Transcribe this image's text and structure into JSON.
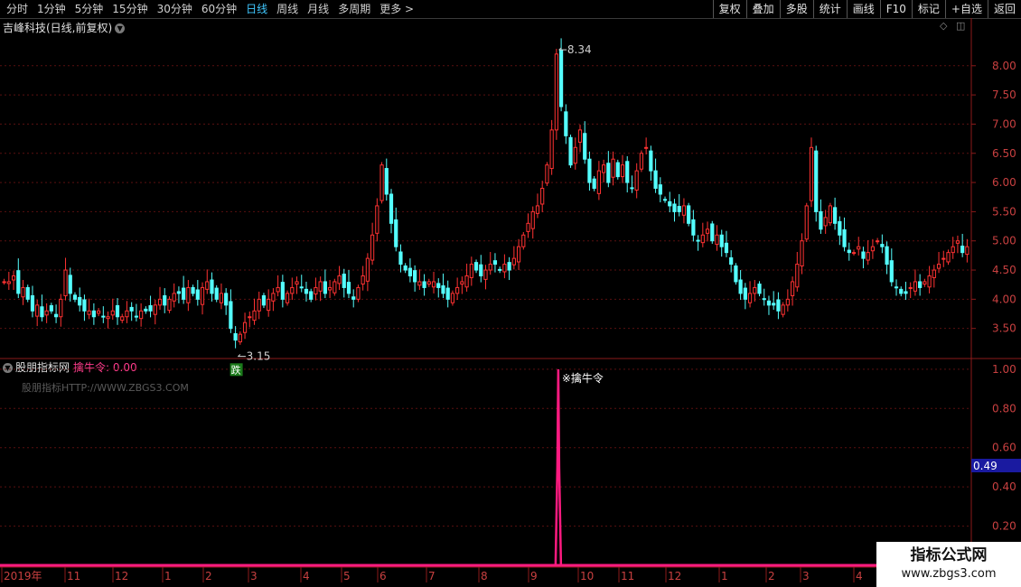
{
  "toolbar": {
    "periods": [
      "分时",
      "1分钟",
      "5分钟",
      "15分钟",
      "30分钟",
      "60分钟",
      "日线",
      "周线",
      "月线",
      "多周期",
      "更多 >"
    ],
    "active_period": "日线",
    "right_buttons": [
      "复权",
      "叠加",
      "多股",
      "统计",
      "画线",
      "F10",
      "标记",
      "+自选",
      "返回"
    ]
  },
  "main_panel": {
    "title": "吉峰科技(日线,前复权)",
    "high_label": "8.34",
    "low_label": "3.15",
    "signal_marker": "跌"
  },
  "indicator_panel": {
    "title": "股朋指标网",
    "value_label": "擒牛令: 0.00",
    "watermark": "股朋指标HTTP://WWW.ZBGS3.COM",
    "spike_label": "※擒牛令",
    "cursor_value": "0.49"
  },
  "chart_data": [
    {
      "type": "candlestick",
      "title": "吉峰科技(日线,前复权)",
      "y_ticks": [
        "8.00",
        "7.50",
        "7.00",
        "6.50",
        "6.00",
        "5.50",
        "5.00",
        "4.50",
        "4.00",
        "3.50"
      ],
      "ylim": [
        3.0,
        8.6
      ],
      "x_ticks": [
        "2019年",
        "11",
        "12",
        "1",
        "2",
        "3",
        "4",
        "5",
        "6",
        "7",
        "8",
        "9",
        "10",
        "11",
        "12",
        "1",
        "2",
        "3",
        "4"
      ],
      "annotations": [
        {
          "text": "8.34",
          "value": 8.34
        },
        {
          "text": "3.15",
          "value": 3.15
        }
      ],
      "close_series": [
        4.3,
        4.3,
        4.4,
        4.1,
        4.2,
        4.0,
        3.8,
        3.9,
        3.7,
        3.8,
        3.8,
        3.7,
        4.0,
        4.5,
        4.1,
        4.0,
        3.9,
        3.8,
        3.8,
        3.7,
        3.8,
        3.7,
        3.7,
        3.8,
        3.7,
        3.7,
        3.8,
        3.8,
        3.7,
        3.8,
        3.8,
        3.8,
        3.9,
        4.0,
        3.9,
        4.0,
        4.1,
        4.1,
        4.0,
        4.2,
        4.1,
        4.0,
        4.2,
        4.3,
        4.1,
        4.0,
        4.1,
        3.9,
        3.5,
        3.3,
        3.4,
        3.6,
        3.7,
        3.8,
        4.0,
        3.9,
        4.0,
        4.1,
        4.2,
        4.0,
        4.1,
        4.2,
        4.3,
        4.2,
        4.1,
        4.0,
        4.2,
        4.3,
        4.1,
        4.2,
        4.3,
        4.4,
        4.2,
        4.1,
        4.0,
        4.2,
        4.4,
        4.7,
        5.1,
        5.6,
        6.3,
        5.8,
        5.3,
        4.9,
        4.6,
        4.5,
        4.4,
        4.3,
        4.3,
        4.2,
        4.3,
        4.3,
        4.2,
        4.1,
        4.0,
        4.1,
        4.2,
        4.3,
        4.4,
        4.6,
        4.5,
        4.4,
        4.5,
        4.6,
        4.6,
        4.5,
        4.6,
        4.5,
        4.7,
        4.9,
        5.1,
        5.3,
        5.5,
        5.6,
        5.9,
        6.3,
        6.9,
        8.2,
        7.3,
        6.8,
        6.3,
        6.6,
        6.9,
        6.4,
        6.0,
        5.9,
        6.2,
        6.3,
        6.0,
        6.4,
        6.1,
        6.3,
        6.0,
        5.9,
        6.2,
        6.5,
        6.6,
        6.2,
        5.9,
        5.8,
        5.7,
        5.6,
        5.5,
        5.5,
        5.6,
        5.3,
        5.1,
        5.0,
        5.1,
        5.2,
        5.0,
        5.1,
        4.9,
        4.8,
        4.6,
        4.3,
        4.1,
        4.0,
        4.1,
        4.2,
        4.1,
        4.0,
        3.9,
        3.9,
        3.8,
        3.9,
        4.0,
        4.3,
        4.6,
        5.0,
        5.6,
        6.6,
        5.5,
        5.2,
        5.4,
        5.6,
        5.3,
        5.1,
        4.9,
        4.8,
        4.8,
        4.9,
        4.7,
        4.8,
        4.9,
        5.0,
        4.9,
        4.6,
        4.3,
        4.2,
        4.1,
        4.1,
        4.2,
        4.3,
        4.2,
        4.3,
        4.4,
        4.5,
        4.6,
        4.7,
        4.8,
        4.9,
        5.0,
        4.8,
        4.9
      ]
    },
    {
      "type": "bar",
      "title": "擒牛令",
      "y_ticks": [
        "1.00",
        "0.80",
        "0.60",
        "0.40",
        "0.20"
      ],
      "ylim": [
        0,
        1.05
      ],
      "series": [
        {
          "name": "擒牛令",
          "spike_index": 117,
          "spike_value": 1.0
        }
      ]
    }
  ],
  "colors": {
    "up": "#ff3232",
    "down": "#54ffff",
    "grid": "#5a1010",
    "spike": "#ff1a80",
    "axis": "#8b1a1a"
  }
}
